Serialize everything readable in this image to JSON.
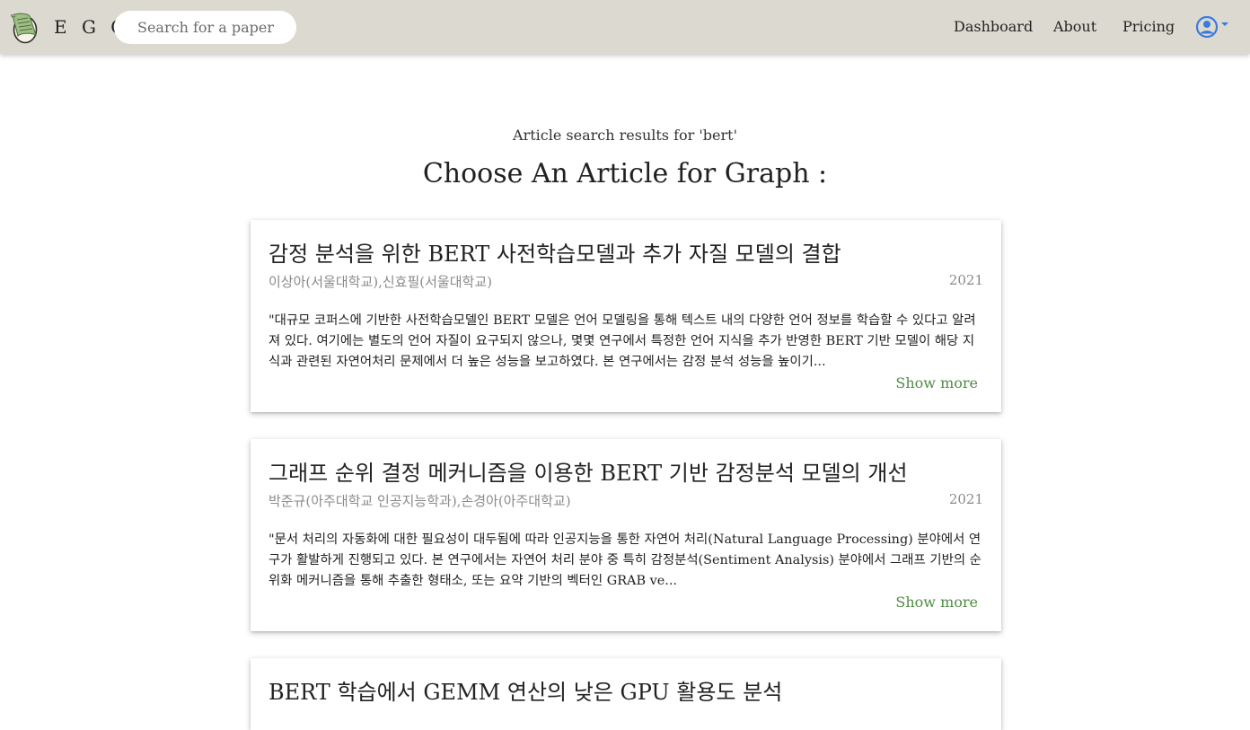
{
  "nav": {
    "brand": "E G G",
    "search_placeholder": "Search for a paper",
    "links": [
      "Dashboard",
      "About",
      "Pricing"
    ]
  },
  "header": {
    "subtitle": "Article search results for 'bert'",
    "title": "Choose An Article for Graph :"
  },
  "articles": [
    {
      "title": "감정 분석을 위한 BERT 사전학습모델과 추가 자질 모델의 결합",
      "authors": "이상아(서울대학교),신효필(서울대학교)",
      "year": "2021",
      "abstract": "\"대규모 코퍼스에 기반한 사전학습모델인 BERT 모델은 언어 모델링을 통해 텍스트 내의 다양한 언어 정보를 학습할 수 있다고 알려져 있다. 여기에는 별도의 언어 자질이 요구되지 않으나, 몇몇 연구에서 특정한 언어 지식을 추가 반영한 BERT 기반 모델이 해당 지식과 관련된 자연어처리 문제에서 더 높은 성능을 보고하였다. 본 연구에서는 감정 분석 성능을 높이기...",
      "show_more": "Show more"
    },
    {
      "title": "그래프 순위 결정 메커니즘을 이용한 BERT 기반 감정분석 모델의 개선",
      "authors": "박준규(아주대학교 인공지능학과),손경아(아주대학교)",
      "year": "2021",
      "abstract": "\"문서 처리의 자동화에 대한 필요성이 대두됨에 따라 인공지능을 통한 자연어 처리(Natural Language Processing) 분야에서 연구가 활발하게 진행되고 있다. 본 연구에서는 자연어 처리 분야 중 특히 감정분석(Sentiment Analysis) 분야에서 그래프 기반의 순위화 메커니즘을 통해 추출한 형태소, 또는 요약 기반의 벡터인 GRAB ve...",
      "show_more": "Show more"
    },
    {
      "title": "BERT 학습에서 GEMM 연산의 낮은 GPU 활용도 분석"
    }
  ],
  "colors": {
    "navbar_bg": "#dcdad0",
    "link_green": "#4f8d43",
    "account_blue": "#3a7be0"
  }
}
